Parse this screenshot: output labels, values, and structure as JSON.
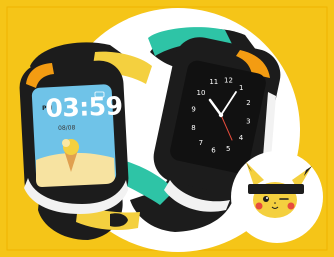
{
  "watch_left": {
    "time": "03:59",
    "ampm": "PM",
    "date": "08/08"
  },
  "watch_right": {
    "dial_numbers": [
      "1",
      "2",
      "3",
      "4",
      "5",
      "6",
      "7",
      "8",
      "9",
      "10",
      "11",
      "12"
    ]
  },
  "colors": {
    "background": "#f5c518",
    "backdrop_circle": "#ffffff",
    "strap_yellow": "#f4d03f",
    "strap_teal": "#2ec4a6",
    "watch_body": "#1c1c1c",
    "accent_orange": "#f39c12",
    "screen_sky": "#6fc3e8"
  },
  "badge": {
    "icon": "pikachu-icon"
  }
}
